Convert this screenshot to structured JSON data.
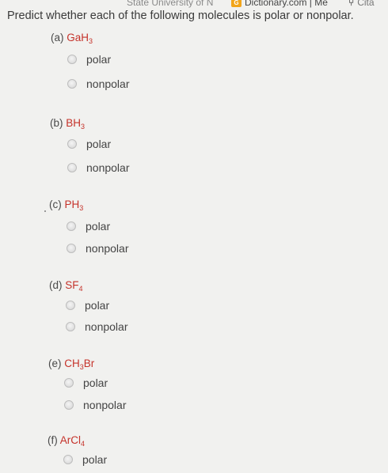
{
  "bookmarks": [
    {
      "label": "State University of N"
    },
    {
      "label": "Dictionary.com | Me",
      "icon": "dictionary-favicon"
    },
    {
      "label": "Cita",
      "icon": "fork-favicon"
    }
  ],
  "question": "Predict whether each of the following molecules is polar or nonpolar.",
  "parts": [
    {
      "label": "(a)",
      "formula": {
        "base": "GaH",
        "sub": "3",
        "tail": ""
      },
      "options": [
        "polar",
        "nonpolar"
      ]
    },
    {
      "label": "(b)",
      "formula": {
        "base": "BH",
        "sub": "3",
        "tail": ""
      },
      "options": [
        "polar",
        "nonpolar"
      ]
    },
    {
      "label": "(c)",
      "formula": {
        "base": "PH",
        "sub": "3",
        "tail": ""
      },
      "options": [
        "polar",
        "nonpolar"
      ]
    },
    {
      "label": "(d)",
      "formula": {
        "base": "SF",
        "sub": "4",
        "tail": ""
      },
      "options": [
        "polar",
        "nonpolar"
      ]
    },
    {
      "label": "(e)",
      "formula": {
        "base": "CH",
        "sub": "3",
        "tail": "Br"
      },
      "options": [
        "polar",
        "nonpolar"
      ]
    },
    {
      "label": "(f)",
      "formula": {
        "base": "ArCl",
        "sub": "4",
        "tail": ""
      },
      "options": [
        "polar"
      ]
    }
  ],
  "colors": {
    "formula": "#c5322a",
    "background": "#f1f1ef"
  }
}
